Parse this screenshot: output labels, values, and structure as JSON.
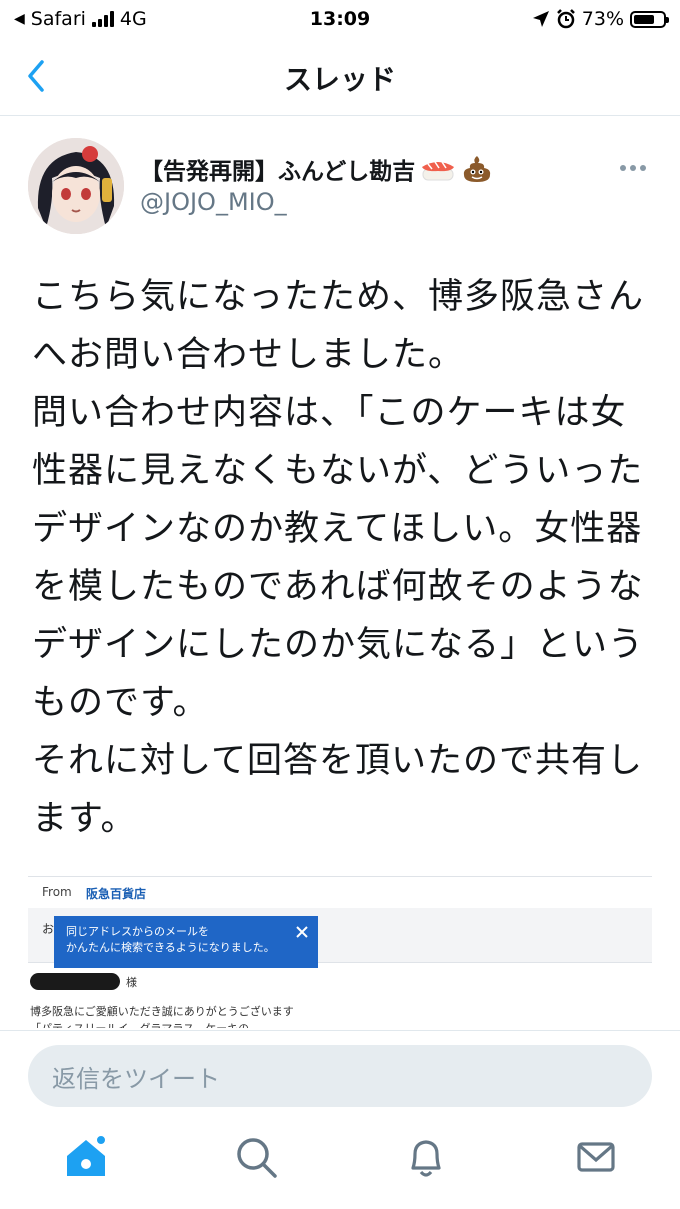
{
  "status_bar": {
    "carrier": "Safari",
    "network": "4G",
    "time": "13:09",
    "battery": "73%",
    "battery_level": 0.73
  },
  "header": {
    "title": "スレッド"
  },
  "tweet": {
    "display_name": "【告発再開】ふんどし勘吉",
    "handle": "@JOJO_MIO_",
    "text_paragraphs": [
      "こちら気になったため、博多阪急さんへお問い合わせしました。",
      "問い合わせ内容は、「このケーキは女性器に見えなくもないが、どういったデザインなのか教えてほしい。女性器を模したものであれば何故そのようなデザインにしたのか気になる」というものです。",
      "それに対して回答を頂いたので共有します。"
    ]
  },
  "media": {
    "from_label": "From",
    "from_value": "阪急百貨店",
    "row2_char": "お",
    "tooltip_line1": "同じアドレスからのメールを",
    "tooltip_line2": "かんたんに検索できるようになりました。",
    "salutation_suffix": "様",
    "body_line1": "博多阪急にご愛顧いただき誠にありがとうございます",
    "body_line2": "「パティスリールイ　グラマラス　ケーキの"
  },
  "reply": {
    "placeholder": "返信をツイート"
  },
  "colors": {
    "accent": "#1da1f2",
    "text": "#14171a",
    "secondary": "#657786"
  }
}
